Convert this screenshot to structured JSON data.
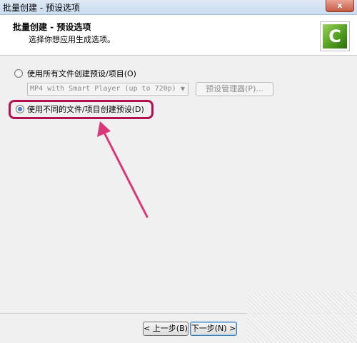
{
  "window": {
    "title": "批量创建 - 预设选项",
    "close_label": "x"
  },
  "header": {
    "title": "批量创建 - 预设选项",
    "subtitle": "选择你想应用生成选项。",
    "logo_letter": "C"
  },
  "options": {
    "same_preset": {
      "label": "使用所有文件创建预设/项目(O)",
      "checked": false,
      "preset_value": "MP4 with Smart Player (up to 720p)",
      "manager_label": "预设管理器(P)..."
    },
    "different_preset": {
      "label": "使用不同的文件/项目创建预设(D)",
      "checked": true
    }
  },
  "footer": {
    "back_label": "< 上一步(B)",
    "next_label": "下一步(N) >"
  },
  "colors": {
    "highlight": "#b3124e",
    "arrow": "#d8387a",
    "logo_green": "#4c9a1f"
  }
}
